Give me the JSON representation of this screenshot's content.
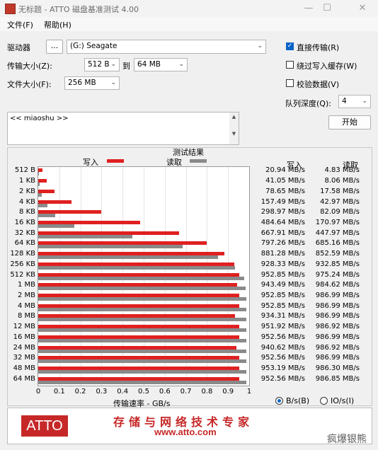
{
  "window": {
    "title": "无标题 - ATTO 磁盘基准测试 4.00",
    "minimize": "—",
    "maximize": "☐",
    "close": "✕"
  },
  "menu": {
    "file": "文件(F)",
    "help": "帮助(H)"
  },
  "settings": {
    "drive_label": "驱动器",
    "browse_button": "...",
    "drive_value": "(G:) Seagate",
    "transfer_size_label": "传输大小(Z):",
    "transfer_from": "512 B",
    "to_label": "到",
    "transfer_to": "64 MB",
    "file_size_label": "文件大小(F):",
    "file_size": "256 MB",
    "direct_io_label": "直接传输(R)",
    "direct_io_checked": true,
    "bypass_cache_label": "绕过写入缓存(W)",
    "bypass_cache_checked": false,
    "verify_label": "校验数据(V)",
    "verify_checked": false,
    "queue_depth_label": "队列深度(Q):",
    "queue_depth": "4",
    "start_button": "开始",
    "description_text": "<< miaoshu >>"
  },
  "results": {
    "title": "测试结果",
    "write_legend": "写入",
    "read_legend": "读取",
    "write_col": "写入",
    "read_col": "读取",
    "write_color": "#e02020",
    "read_color": "#8a8a8a"
  },
  "units": {
    "bs_label": "B/s(B)",
    "ios_label": "IO/s(I)",
    "bs_selected": true
  },
  "banner": {
    "logo": "ATTO",
    "slogan": "存储与网络技术专家",
    "url": "www.atto.com"
  },
  "watermark": "疯爆银熊",
  "chart_data": {
    "type": "bar",
    "orientation": "horizontal",
    "xlabel": "传输速率 - GB/s",
    "xlim": [
      0,
      1
    ],
    "xticks": [
      "0",
      "0.1",
      "0.2",
      "0.3",
      "0.4",
      "0.5",
      "0.6",
      "0.7",
      "0.8",
      "0.9",
      "1"
    ],
    "grid": true,
    "categories": [
      "512 B",
      "1 KB",
      "2 KB",
      "4 KB",
      "8 KB",
      "16 KB",
      "32 KB",
      "64 KB",
      "128 KB",
      "256 KB",
      "512 KB",
      "1 MB",
      "2 MB",
      "4 MB",
      "8 MB",
      "12 MB",
      "16 MB",
      "24 MB",
      "32 MB",
      "48 MB",
      "64 MB"
    ],
    "series": [
      {
        "name": "写入",
        "values": [
          0.02094,
          0.04105,
          0.07865,
          0.15749,
          0.29897,
          0.48464,
          0.66791,
          0.79726,
          0.88128,
          0.92833,
          0.95285,
          0.94349,
          0.95285,
          0.95285,
          0.93431,
          0.95192,
          0.95256,
          0.94062,
          0.95256,
          0.95319,
          0.95256
        ],
        "labels": [
          "20.94 MB/s",
          "41.05 MB/s",
          "78.65 MB/s",
          "157.49 MB/s",
          "298.97 MB/s",
          "484.64 MB/s",
          "667.91 MB/s",
          "797.26 MB/s",
          "881.28 MB/s",
          "928.33 MB/s",
          "952.85 MB/s",
          "943.49 MB/s",
          "952.85 MB/s",
          "952.85 MB/s",
          "934.31 MB/s",
          "951.92 MB/s",
          "952.56 MB/s",
          "940.62 MB/s",
          "952.56 MB/s",
          "953.19 MB/s",
          "952.56 MB/s"
        ]
      },
      {
        "name": "读取",
        "values": [
          0.00483,
          0.00806,
          0.01758,
          0.04297,
          0.08209,
          0.17097,
          0.44797,
          0.68516,
          0.85259,
          0.93285,
          0.97524,
          0.98462,
          0.98699,
          0.98699,
          0.98699,
          0.98692,
          0.98699,
          0.98692,
          0.98699,
          0.9863,
          0.98685
        ],
        "labels": [
          "4.83 MB/s",
          "8.06 MB/s",
          "17.58 MB/s",
          "42.97 MB/s",
          "82.09 MB/s",
          "170.97 MB/s",
          "447.97 MB/s",
          "685.16 MB/s",
          "852.59 MB/s",
          "932.85 MB/s",
          "975.24 MB/s",
          "984.62 MB/s",
          "986.99 MB/s",
          "986.99 MB/s",
          "986.99 MB/s",
          "986.92 MB/s",
          "986.99 MB/s",
          "986.92 MB/s",
          "986.99 MB/s",
          "986.30 MB/s",
          "986.85 MB/s"
        ]
      }
    ]
  }
}
